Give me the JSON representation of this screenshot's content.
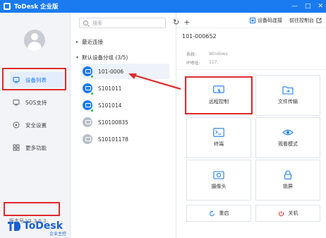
{
  "titlebar": {
    "title": "ToDesk 企业版",
    "controls": [
      "—",
      "□",
      "✕"
    ]
  },
  "sidebar": {
    "username": "",
    "items": [
      {
        "label": "设备列表",
        "active": true
      },
      {
        "label": "SOS支持"
      },
      {
        "label": "安全设置"
      },
      {
        "label": "更多功能"
      }
    ],
    "version": "版本号 V1.3.0.3",
    "logo_brand": "ToDesk",
    "logo_sub": "企业主控"
  },
  "middle": {
    "search_placeholder": "搜索",
    "refresh_glyph": "↻",
    "add_glyph": "+",
    "recent_label": "最近连接",
    "default_group_label": "默认设备分组 (3/5)",
    "devices": [
      {
        "name": "101-0006",
        "online": true
      },
      {
        "name": "S101011",
        "online": true
      },
      {
        "name": "S101014",
        "online": true
      },
      {
        "name": "S10100835",
        "online": false
      },
      {
        "name": "S10101178",
        "online": false
      }
    ]
  },
  "header": {
    "device_code_connect": "设备码连接",
    "goto_console": "前往控制台"
  },
  "detail": {
    "device_id": "101-000652",
    "system_label": "系统:",
    "system_value": "Windows",
    "ip_label": "IP地址:",
    "ip_value": "117.",
    "tiles": {
      "remote_control": "远程控制",
      "file_transfer": "文件传输",
      "terminal": "终端",
      "view_mode": "观看模式",
      "camera": "摄像头",
      "lock_screen": "锁屏"
    },
    "restart": "重启",
    "shutdown": "关机"
  },
  "colors": {
    "accent": "#1a7bf0",
    "highlight": "#e12a2a",
    "online": "#19b955"
  }
}
